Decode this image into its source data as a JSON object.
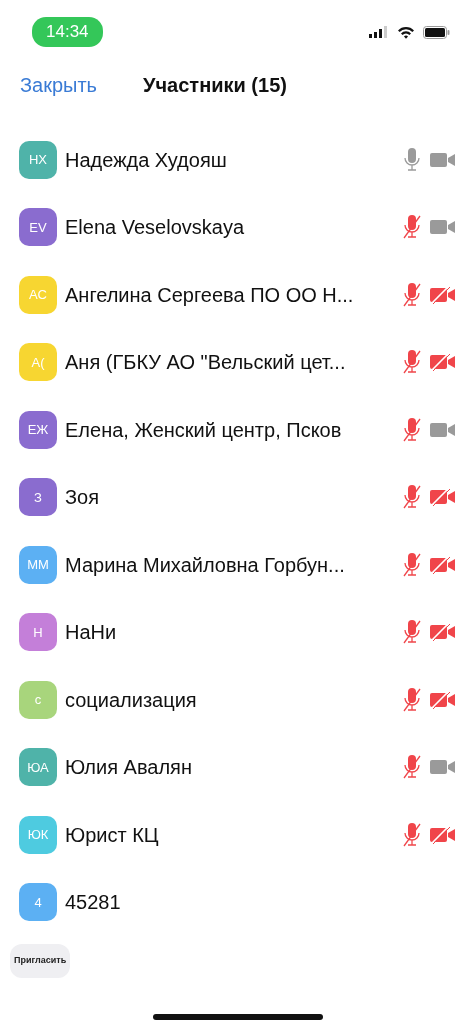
{
  "status_bar": {
    "time": "14:34"
  },
  "header": {
    "close": "Закрыть",
    "title": "Участники (15)"
  },
  "participants": [
    {
      "initials": "НХ",
      "color": "#4fb3a9",
      "name": "Надежда Худояш",
      "mic_muted": false,
      "video_off": false
    },
    {
      "initials": "EV",
      "color": "#8a6ccf",
      "name": "Elena Veselovskaya",
      "mic_muted": true,
      "video_off": false
    },
    {
      "initials": "АС",
      "color": "#f7d631",
      "name": "Ангелина Сергеева ПО ОО Н...",
      "mic_muted": true,
      "video_off": true
    },
    {
      "initials": "А(",
      "color": "#f7d631",
      "name": "Аня (ГБКУ АО \"Вельский цет...",
      "mic_muted": true,
      "video_off": true
    },
    {
      "initials": "ЕЖ",
      "color": "#8a6ccf",
      "name": "Елена, Женский центр, Псков",
      "mic_muted": true,
      "video_off": false
    },
    {
      "initials": "З",
      "color": "#8a6ccf",
      "name": "Зоя",
      "mic_muted": true,
      "video_off": true
    },
    {
      "initials": "ММ",
      "color": "#5cb0f3",
      "name": "Марина Михайловна Горбун...",
      "mic_muted": true,
      "video_off": true
    },
    {
      "initials": "Н",
      "color": "#c47fd9",
      "name": "НаНи",
      "mic_muted": true,
      "video_off": true
    },
    {
      "initials": "с",
      "color": "#a8d57c",
      "name": "социализация",
      "mic_muted": true,
      "video_off": true
    },
    {
      "initials": "ЮА",
      "color": "#4fb3a9",
      "name": "Юлия Авалян",
      "mic_muted": true,
      "video_off": false
    },
    {
      "initials": "ЮК",
      "color": "#4ecbe0",
      "name": "Юрист КЦ",
      "mic_muted": true,
      "video_off": true
    },
    {
      "initials": "4",
      "color": "#5cb0f3",
      "name": "45281"
    }
  ],
  "invite_button": "Пригласить"
}
